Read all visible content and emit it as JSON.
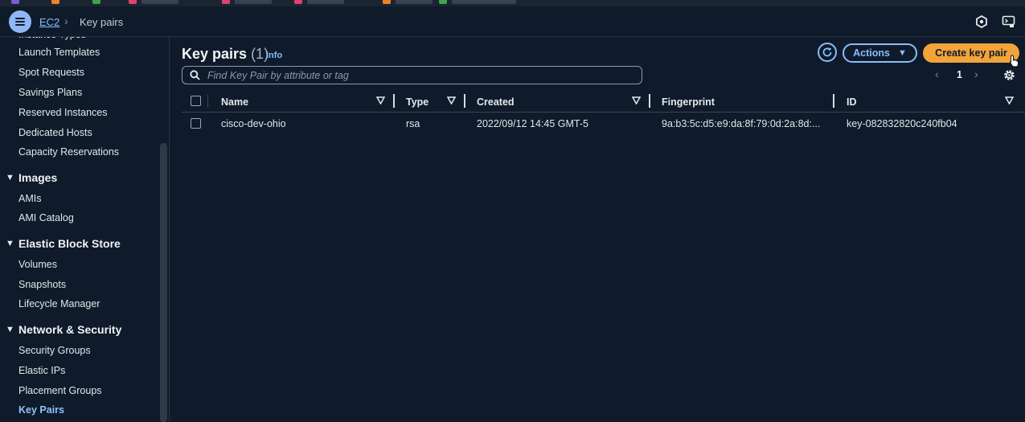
{
  "header": {
    "breadcrumb_root": "EC2",
    "breadcrumb_current": "Key pairs"
  },
  "sidebar": {
    "items_top": [
      "Launch Templates",
      "Spot Requests",
      "Savings Plans",
      "Reserved Instances",
      "Dedicated Hosts",
      "Capacity Reservations"
    ],
    "sections": {
      "images": {
        "title": "Images",
        "items": [
          "AMIs",
          "AMI Catalog"
        ]
      },
      "ebs": {
        "title": "Elastic Block Store",
        "items": [
          "Volumes",
          "Snapshots",
          "Lifecycle Manager"
        ]
      },
      "network": {
        "title": "Network & Security",
        "items": [
          "Security Groups",
          "Elastic IPs",
          "Placement Groups",
          "Key Pairs"
        ]
      }
    },
    "active_item": "Key Pairs"
  },
  "main": {
    "title": "Key pairs",
    "count": "(1)",
    "info": "Info",
    "actions_label": "Actions",
    "create_label": "Create key pair",
    "search_placeholder": "Find Key Pair by attribute or tag",
    "page_number": "1"
  },
  "table": {
    "columns": [
      "Name",
      "Type",
      "Created",
      "Fingerprint",
      "ID"
    ],
    "rows": [
      {
        "name": "cisco-dev-ohio",
        "type": "rsa",
        "created": "2022/09/12 14:45 GMT-5",
        "fingerprint": "9a:b3:5c:d5:e9:da:8f:79:0d:2a:8d:...",
        "id": "key-082832820c240fb04"
      }
    ]
  },
  "colors": {
    "background": "#0f1b2a",
    "link": "#89bdff",
    "primary_button": "#f2a33a",
    "menu_button": "#8fb7f7"
  },
  "icons": [
    "hamburger-icon",
    "chevron-right-icon",
    "notifications-icon",
    "cloudshell-icon",
    "triangle-down-icon",
    "refresh-icon",
    "caret-down-icon",
    "search-icon",
    "chevron-left-icon",
    "gear-icon",
    "sort-icon",
    "pointer-cursor-icon"
  ]
}
